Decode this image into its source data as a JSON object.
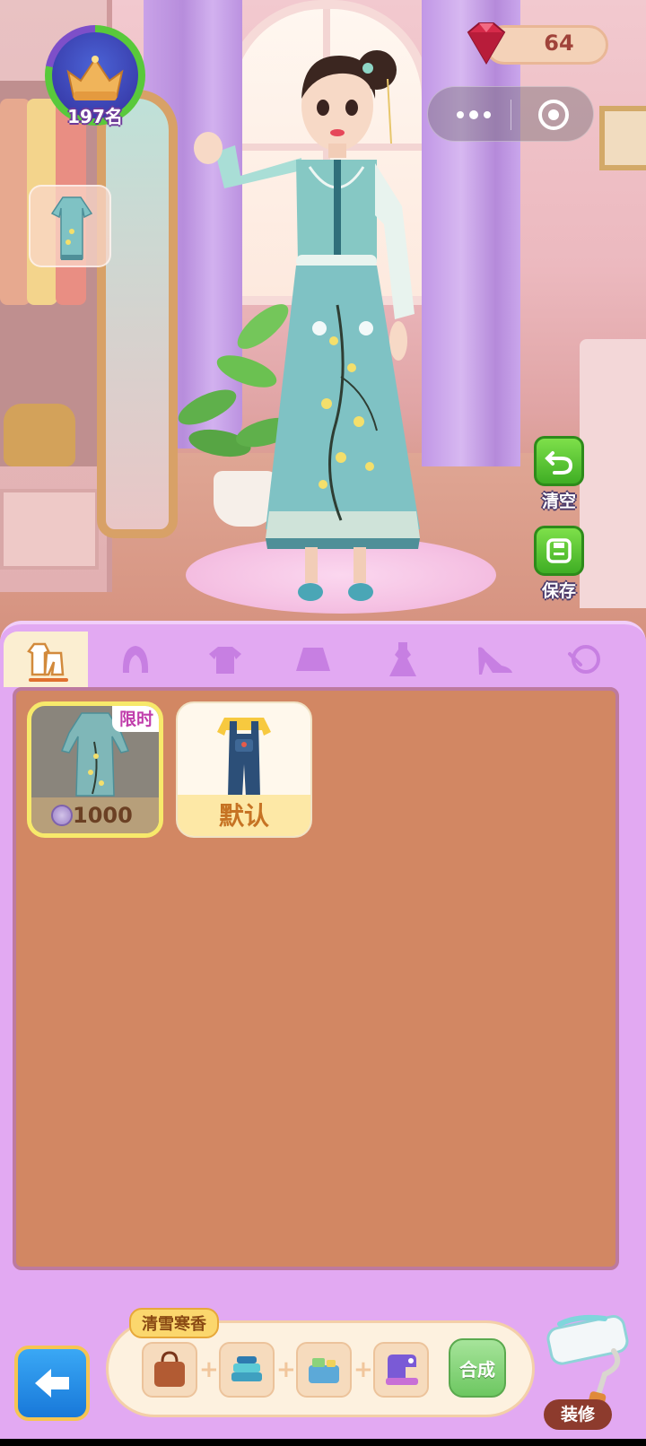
{
  "hud": {
    "rank_label": "197名",
    "gem_count": "64",
    "icons": {
      "crown": "crown-icon",
      "gem": "ruby-gem-icon",
      "menu": "more-dots-icon",
      "close": "target-circle-icon"
    }
  },
  "side_buttons": {
    "clear_label": "清空",
    "save_label": "保存"
  },
  "tabs": [
    {
      "icon": "outfit-icon",
      "active": true
    },
    {
      "icon": "hair-icon",
      "active": false
    },
    {
      "icon": "top-icon",
      "active": false
    },
    {
      "icon": "skirt-icon",
      "active": false
    },
    {
      "icon": "dress-icon",
      "active": false
    },
    {
      "icon": "heels-icon",
      "active": false
    },
    {
      "icon": "accessory-icon",
      "active": false
    }
  ],
  "items": [
    {
      "badge": "限时",
      "price": "1000",
      "selected": true
    },
    {
      "label": "默认",
      "selected": false
    }
  ],
  "craft": {
    "title": "清雪寒香",
    "merge_label": "合成",
    "plus": "+"
  },
  "decor_label": "装修",
  "colors": {
    "panel": "#e2a9f2",
    "items_bg": "#d28763",
    "accent_green": "#3fae24",
    "back_blue": "#1878d9"
  }
}
